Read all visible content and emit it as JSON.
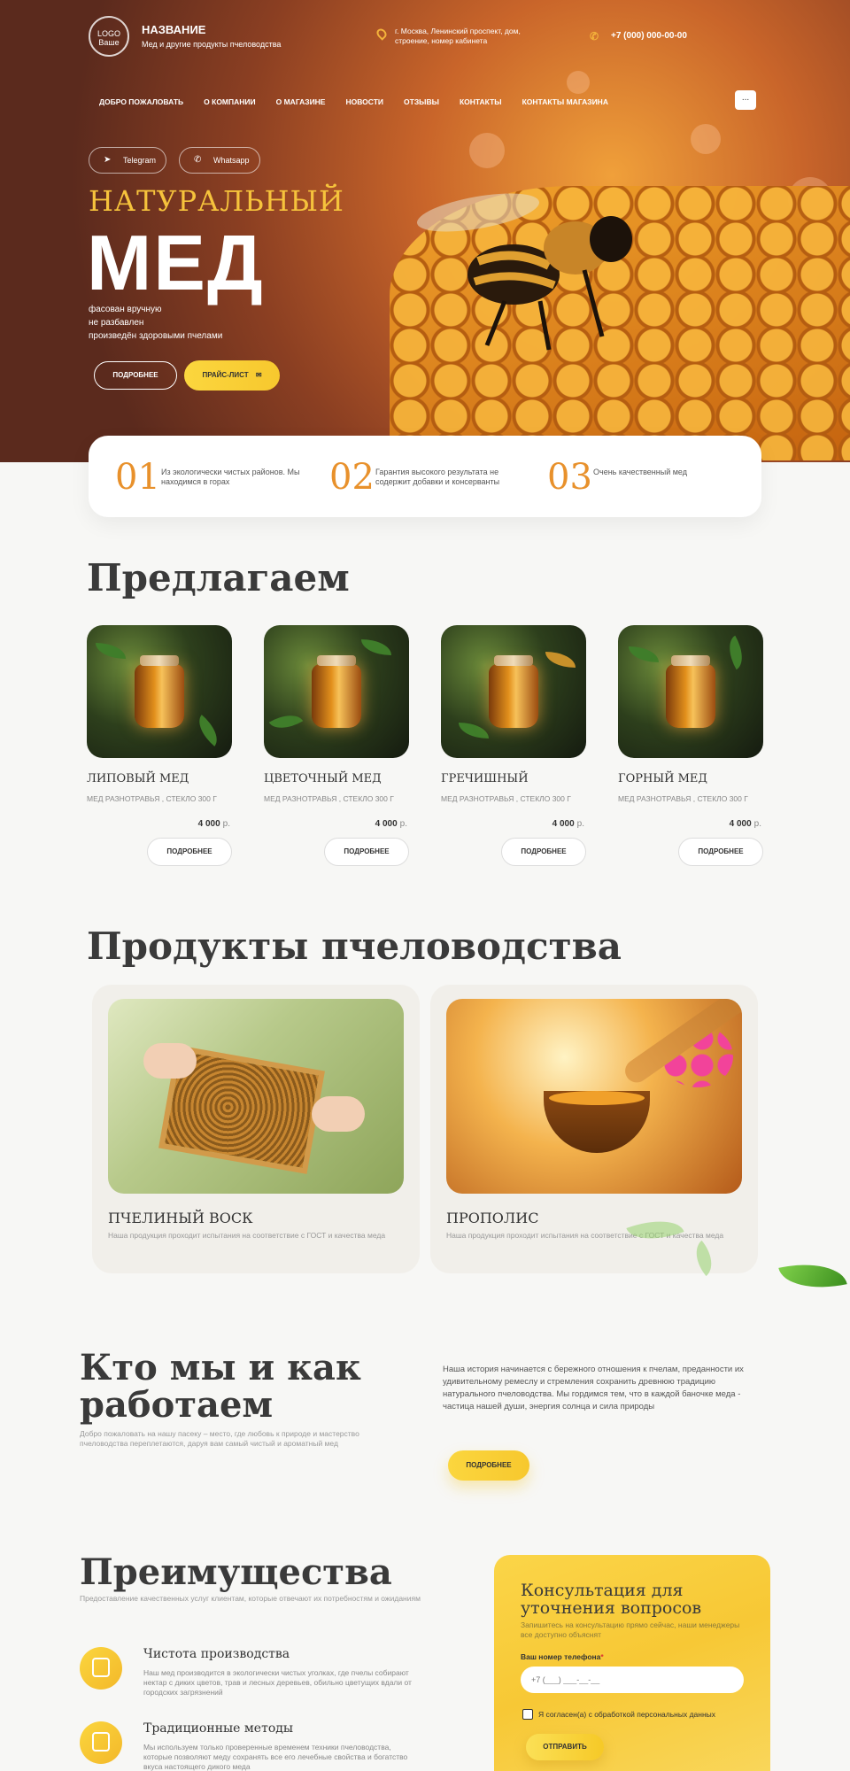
{
  "header": {
    "logo_line1": "LOGO",
    "logo_line2": "Ваше",
    "name": "НАЗВАНИЕ",
    "tagline": "Мед и другие продукты пчеловодства",
    "address": "г. Москва, Ленинский проспект, дом, строение, номер кабинета",
    "phone": "+7 (000) 000-00-00",
    "menu_label": "..."
  },
  "nav": [
    "ДОБРО ПОЖАЛОВАТЬ",
    "О КОМПАНИИ",
    "О МАГАЗИНЕ",
    "НОВОСТИ",
    "ОТЗЫВЫ",
    "КОНТАКТЫ",
    "КОНТАКТЫ МАГАЗИНА"
  ],
  "hero": {
    "telegram": "Telegram",
    "whatsapp": "Whatsapp",
    "kicker": "НАТУРАЛЬНЫЙ",
    "title": "МЕД",
    "lines": [
      "фасован вручную",
      "не разбавлен",
      "произведён здоровыми пчелами"
    ],
    "btn_more": "ПОДРОБНЕЕ",
    "btn_price": "ПРАЙС-ЛИСТ"
  },
  "stats": [
    {
      "num": "01",
      "text": "Из экологически чистых районов. Мы находимся в горах"
    },
    {
      "num": "02",
      "text": "Гарантия высокого результата не содержит добавки и консерванты"
    },
    {
      "num": "03",
      "text": "Очень качественный мед"
    }
  ],
  "offers": {
    "title": "Предлагаем",
    "items": [
      {
        "name": "ЛИПОВЫЙ МЕД",
        "desc": "МЕД РАЗНОТРАВЬЯ , СТЕКЛО 300 Г",
        "price": "4 000",
        "currency": "р.",
        "btn": "ПОДРОБНЕЕ"
      },
      {
        "name": "ЦВЕТОЧНЫЙ МЕД",
        "desc": "МЕД РАЗНОТРАВЬЯ , СТЕКЛО 300 Г",
        "price": "4 000",
        "currency": "р.",
        "btn": "ПОДРОБНЕЕ"
      },
      {
        "name": "ГРЕЧИШНЫЙ",
        "desc": "МЕД РАЗНОТРАВЬЯ , СТЕКЛО 300 Г",
        "price": "4 000",
        "currency": "р.",
        "btn": "ПОДРОБНЕЕ"
      },
      {
        "name": "ГОРНЫЙ МЕД",
        "desc": "МЕД РАЗНОТРАВЬЯ , СТЕКЛО 300 Г",
        "price": "4 000",
        "currency": "р.",
        "btn": "ПОДРОБНЕЕ"
      }
    ]
  },
  "products": {
    "title": "Продукты пчеловодства",
    "items": [
      {
        "name": "ПЧЕЛИНЫЙ ВОСК",
        "desc": "Наша продукция проходит испытания  на соответствие с ГОСТ и качества меда"
      },
      {
        "name": "ПРОПОЛИС",
        "desc": "Наша продукция проходит испытания  на соответствие с ГОСТ и качества меда"
      }
    ]
  },
  "about": {
    "title": "Кто мы и как работаем",
    "subtitle": "Добро пожаловать на нашу пасеку – место, где любовь к природе и мастерство пчеловодства переплетаются, даруя вам самый чистый и ароматный мед",
    "text": "Наша история начинается с бережного отношения к пчелам, преданности их удивительному ремеслу и стремления сохранить древнюю традицию натурального пчеловодства. Мы гордимся тем, что в каждой баночке меда - частица нашей души, энергия солнца и сила природы",
    "btn": "ПОДРОБНЕЕ"
  },
  "advantages": {
    "title": "Преимущества",
    "subtitle": "Предоставление качественных услуг клиентам, которые отвечают их потребностям и ожиданиям",
    "items": [
      {
        "title": "Чистота производства",
        "text": "Наш мед производится в экологически чистых уголках, где пчелы собирают нектар с диких цветов, трав и лесных деревьев, обильно цветущих вдали от городских загрязнений"
      },
      {
        "title": "Традиционные методы",
        "text": "Мы используем только проверенные временем техники пчеловодства, которые позволяют меду сохранять все его лечебные свойства и богатство вкуса настоящего дикого меда"
      }
    ]
  },
  "consult": {
    "title": "Консультация для уточнения вопросов",
    "subtitle": "Запишитесь на консультацию прямо сейчас, наши менеджеры все доступно объяснят",
    "label": "Ваш номер телефона",
    "required": "*",
    "placeholder": "+7 (___) ___-__-__",
    "consent": "Я согласен(а) с обработкой персональных данных",
    "btn": "ОТПРАВИТЬ"
  },
  "colors": {
    "accent": "#f7c82e",
    "orange": "#e8912c",
    "text": "#333333"
  }
}
